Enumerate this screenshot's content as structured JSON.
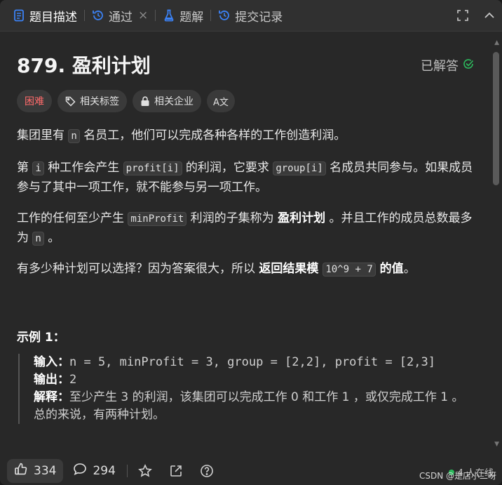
{
  "tabs": [
    {
      "label": "题目描述",
      "icon": "description-icon"
    },
    {
      "label": "通过",
      "icon": "history-icon",
      "close": "×"
    },
    {
      "label": "题解",
      "icon": "flask-icon"
    },
    {
      "label": "提交记录",
      "icon": "history-icon"
    }
  ],
  "problem": {
    "title": "879. 盈利计划",
    "status": "已解答",
    "tags": {
      "difficulty": "困难",
      "related_tags": "相关标签",
      "related_companies": "相关企业",
      "lang_icon": "A文"
    }
  },
  "description": {
    "p1": {
      "a": "集团里有 ",
      "code1": "n",
      "b": " 名员工，他们可以完成各种各样的工作创造利润。"
    },
    "p2": {
      "a": "第 ",
      "code1": "i",
      "b": " 种工作会产生 ",
      "code2": "profit[i]",
      "c": " 的利润，它要求 ",
      "code3": "group[i]",
      "d": " 名成员共同参与。如果成员参与了其中一项工作，就不能参与另一项工作。"
    },
    "p3": {
      "a": "工作的任何至少产生 ",
      "code1": "minProfit",
      "b": " 利润的子集称为 ",
      "bold1": "盈利计划",
      "c": " 。并且工作的成员总数最多为 ",
      "code2": "n",
      "d": " 。"
    },
    "p4": {
      "a": "有多少种计划可以选择？因为答案很大，所以 ",
      "bold1": "返回结果模 ",
      "code1": "10^9 + 7",
      "bold2": " 的值",
      "c": "。"
    }
  },
  "example": {
    "title": "示例 1：",
    "input_label": "输入：",
    "input": "n = 5, minProfit = 3, group = [2,2], profit = [2,3]",
    "output_label": "输出：",
    "output": "2",
    "explain_label": "解释：",
    "explain": "至少产生 3 的利润，该集团可以完成工作 0 和工作 1 ，或仅完成工作 1 。",
    "explain2": "总的来说，有两种计划。"
  },
  "bottom": {
    "likes": "334",
    "comments": "294",
    "online": "4 人在线",
    "watermark": "CSDN @是店小二呀"
  }
}
